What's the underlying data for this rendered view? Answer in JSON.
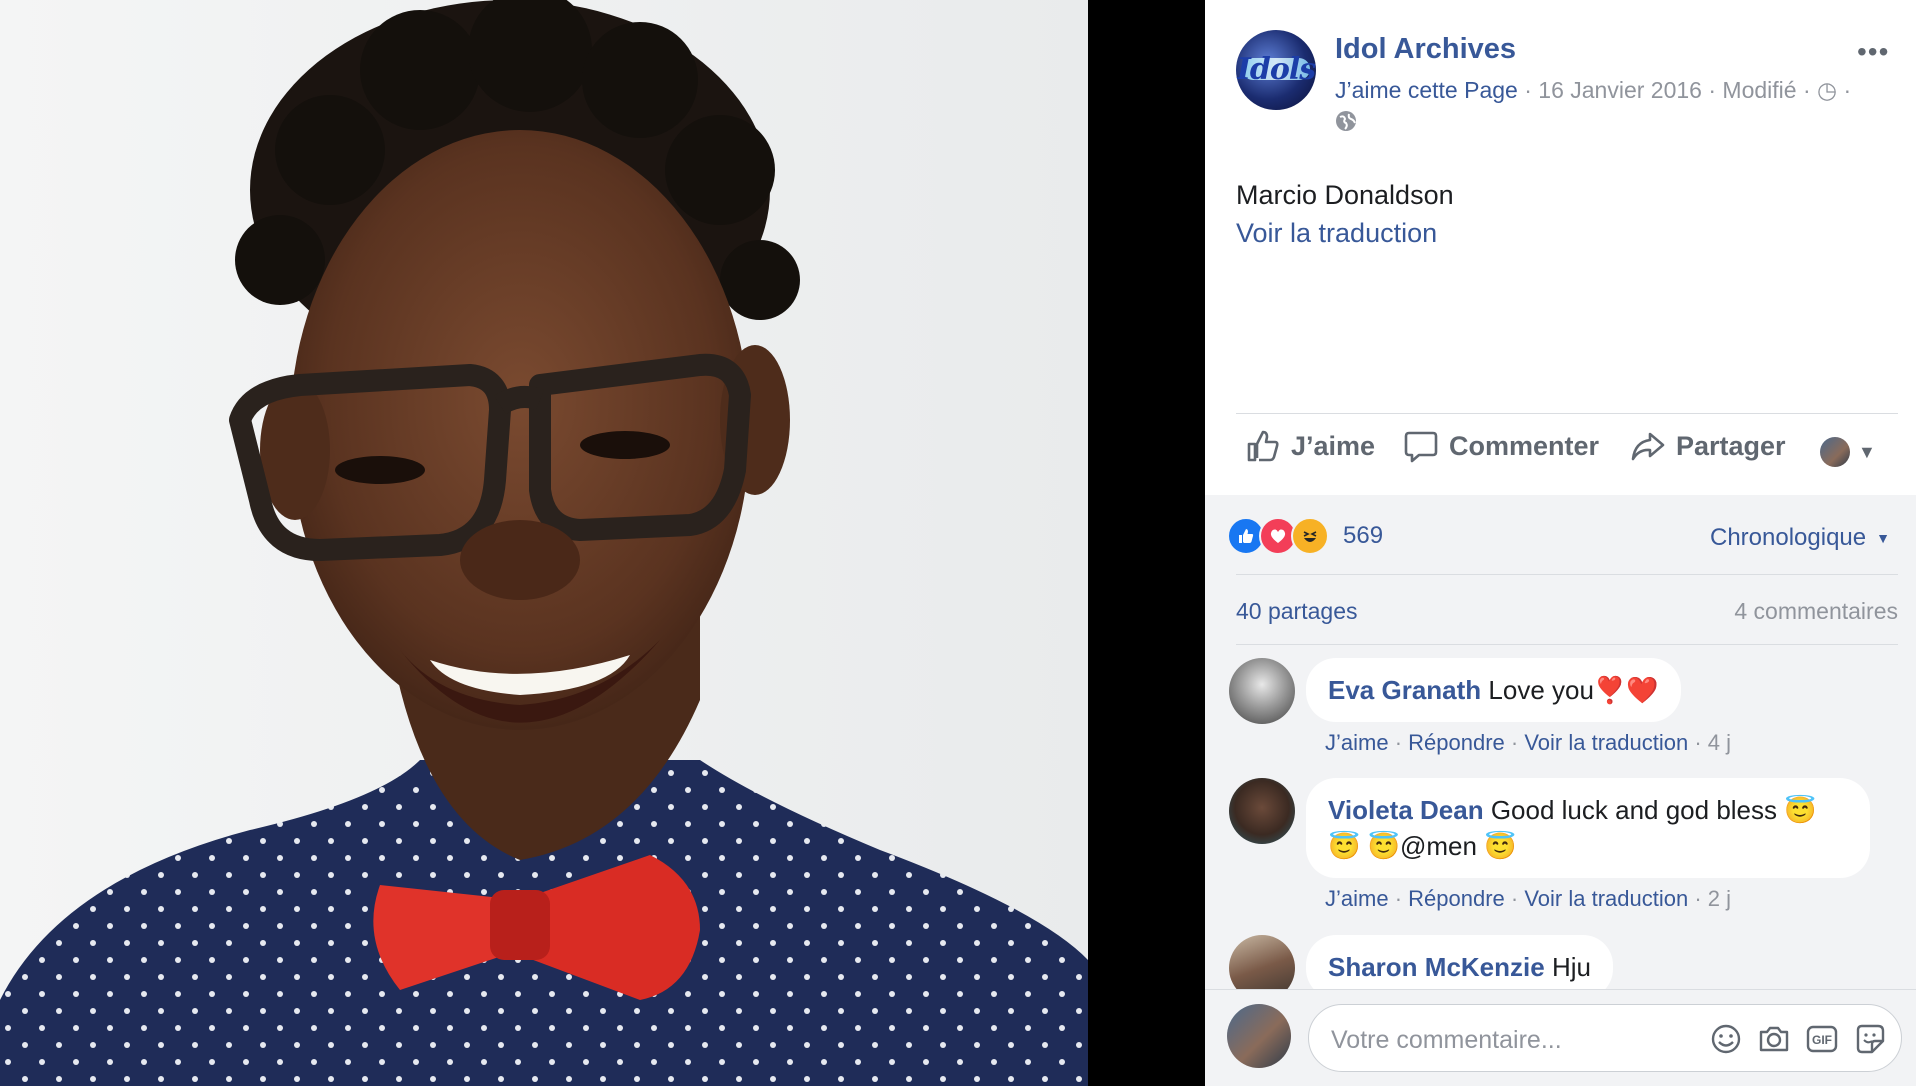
{
  "post": {
    "page_name": "Idol Archives",
    "avatar_text": "Idols",
    "like_page": "J’aime cette Page",
    "date": "16 Janvier 2016",
    "modified": "Modifié",
    "more": "•••",
    "text": "Marcio Donaldson",
    "see_translation": "Voir la traduction"
  },
  "actions": {
    "like": "J’aime",
    "comment": "Commenter",
    "share": "Partager"
  },
  "reactions": {
    "count": "569",
    "sort": "Chronologique",
    "shares": "40 partages",
    "comments": "4 commentaires"
  },
  "comments": [
    {
      "author": "Eva Granath",
      "text": "Love you❣️❤️",
      "like": "J’aime",
      "reply": "Répondre",
      "translate": "Voir la traduction",
      "time": "4 j"
    },
    {
      "author": "Violeta Dean",
      "text": "Good luck and god bless 😇",
      "text2": "😇 😇@men 😇",
      "like": "J’aime",
      "reply": "Répondre",
      "translate": "Voir la traduction",
      "time": "2 j"
    },
    {
      "author": "Sharon McKenzie",
      "text": "Hju"
    }
  ],
  "composer": {
    "placeholder": "Votre commentaire..."
  },
  "colors": {
    "link": "#385898",
    "meta": "#90949c",
    "like_blue": "#1877f2",
    "love_red": "#f33e58",
    "haha_yellow": "#f7b125"
  }
}
